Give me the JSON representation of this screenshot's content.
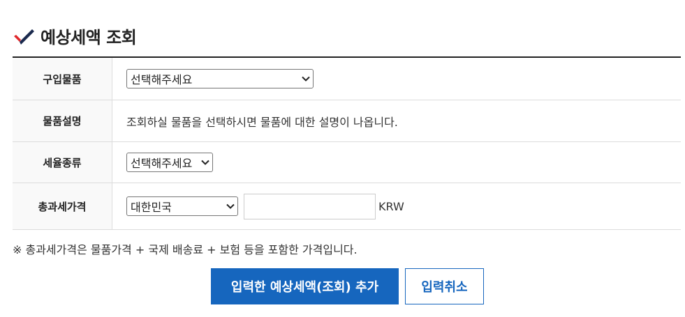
{
  "header": {
    "title": "예상세액 조회",
    "icon": "check-icon",
    "icon_colors": {
      "red": "#e0272b",
      "navy": "#1b2a4e"
    }
  },
  "form": {
    "rows": [
      {
        "label": "구입물품",
        "select_value": "선택해주세요"
      },
      {
        "label": "물품설명",
        "value": "조회하실 물품을 선택하시면 물품에 대한 설명이 나옵니다."
      },
      {
        "label": "세율종류",
        "select_value": "선택해주세요"
      },
      {
        "label": "총과세가격",
        "select_value": "대한민국",
        "input_value": "",
        "unit": "KRW"
      }
    ]
  },
  "note": "※  총과세가격은 물품가격 + 국제 배송료 + 보험 등을 포함한 가격입니다.",
  "buttons": {
    "add": "입력한 예상세액(조회) 추가",
    "cancel": "입력취소"
  },
  "colors": {
    "primary": "#1666be",
    "border": "#dcdcdc",
    "header_bg": "#f9f9f9",
    "top_rule": "#222222"
  }
}
